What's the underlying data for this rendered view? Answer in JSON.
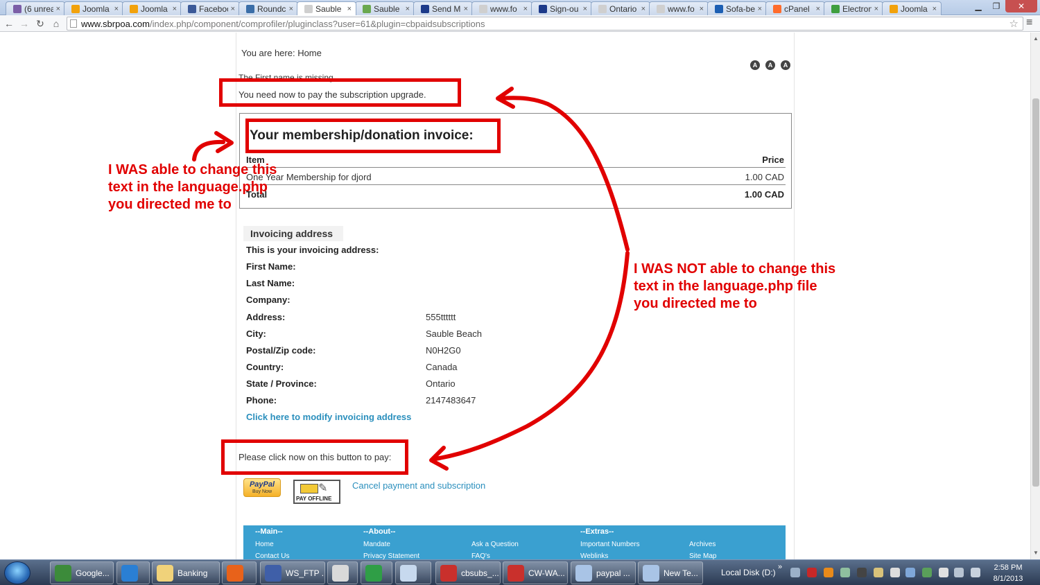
{
  "browser": {
    "tabs": [
      {
        "label": "(6 unrea",
        "color": "#7b5ea7"
      },
      {
        "label": "Joomla",
        "color": "#f2a20c"
      },
      {
        "label": "Joomla",
        "color": "#f2a20c"
      },
      {
        "label": "Faceboo",
        "color": "#3b5998"
      },
      {
        "label": "Roundc",
        "color": "#3b6ea8"
      },
      {
        "label": "Sauble",
        "color": "#cfcfcf"
      },
      {
        "label": "Sauble",
        "color": "#6aa84f"
      },
      {
        "label": "Send M",
        "color": "#1d3a8a"
      },
      {
        "label": "www.fo",
        "color": "#cfcfcf"
      },
      {
        "label": "Sign-ou",
        "color": "#1d3a8a"
      },
      {
        "label": "Ontario",
        "color": "#cfcfcf"
      },
      {
        "label": "www.fo",
        "color": "#cfcfcf"
      },
      {
        "label": "Sofa-be",
        "color": "#1d5fb3"
      },
      {
        "label": "cPanel",
        "color": "#ff6c2c"
      },
      {
        "label": "Electron",
        "color": "#3f9f3f"
      },
      {
        "label": "Joomla",
        "color": "#f2a20c"
      }
    ],
    "url_host": "www.sbrpoa.com",
    "url_path": "/index.php/component/comprofiler/pluginclass?user=61&plugin=cbpaidsubscriptions"
  },
  "page": {
    "breadcrumb": "You are here:  Home",
    "error_msg": "The First name is missing",
    "notice": "You need now to pay the subscription upgrade.",
    "font_buttons": [
      "A",
      "A",
      "A"
    ],
    "invoice_title": "Your membership/donation invoice:",
    "table": {
      "col_item": "Item",
      "col_price": "Price",
      "row_item": "One Year Membership for djord",
      "row_price": "1.00 CAD",
      "total_label": "Total",
      "total_price": "1.00 CAD"
    },
    "address": {
      "heading": "Invoicing address",
      "intro": "This is your invoicing address:",
      "fields": [
        {
          "label": "First Name:",
          "value": ""
        },
        {
          "label": "Last Name:",
          "value": ""
        },
        {
          "label": "Company:",
          "value": ""
        },
        {
          "label": "Address:",
          "value": "555tttttt"
        },
        {
          "label": "City:",
          "value": "Sauble Beach"
        },
        {
          "label": "Postal/Zip code:",
          "value": "N0H2G0"
        },
        {
          "label": "Country:",
          "value": "Canada"
        },
        {
          "label": "State / Province:",
          "value": "Ontario"
        },
        {
          "label": "Phone:",
          "value": "2147483647"
        }
      ],
      "modify_link": "Click here to modify invoicing address"
    },
    "pay_prompt": "Please click now on this button to pay:",
    "paypal": {
      "brand": "PayPal",
      "sub": "Buy Now"
    },
    "offline_label": "PAY OFFLINE",
    "cancel_link": "Cancel payment and subscription",
    "footer": {
      "main_head": "--Main--",
      "main_items": [
        "Home",
        "Contact Us"
      ],
      "about_head": "--About--",
      "about_col1": [
        "Mandate",
        "Privacy Statement"
      ],
      "about_col2": [
        "Ask a Question",
        "FAQ's"
      ],
      "extras_head": "--Extras--",
      "extras_col1": [
        "Important Numbers",
        "Weblinks"
      ],
      "extras_col2": [
        "Archives",
        "Site Map"
      ]
    }
  },
  "annotations": {
    "left_note": [
      "I WAS able to change this",
      "text in the language.php",
      "you directed me to"
    ],
    "right_note": [
      "I WAS NOT able to change this",
      "text in the language.php file",
      "you directed me to"
    ],
    "color": "#e10000"
  },
  "taskbar": {
    "items": [
      {
        "label": "Google...",
        "color": "#3c8b3a"
      },
      {
        "label": "",
        "color": "#2a7fd4"
      },
      {
        "label": "Banking",
        "color": "#f0d27a"
      },
      {
        "label": "",
        "color": "#e8621a"
      },
      {
        "label": "WS_FTP ...",
        "color": "#3f5fa8"
      },
      {
        "label": "",
        "color": "#d9d9d9"
      },
      {
        "label": "",
        "color": "#2f9e46"
      },
      {
        "label": "",
        "color": "#c7d9ee"
      },
      {
        "label": "cbsubs_...",
        "color": "#c9302c"
      },
      {
        "label": "CW-WA...",
        "color": "#c9302c"
      },
      {
        "label": "paypal ...",
        "color": "#a9c4e6"
      },
      {
        "label": "New Te...",
        "color": "#a9c4e6"
      }
    ],
    "local_disk": "Local Disk (D:)",
    "time": "2:58 PM",
    "date": "8/1/2013"
  }
}
